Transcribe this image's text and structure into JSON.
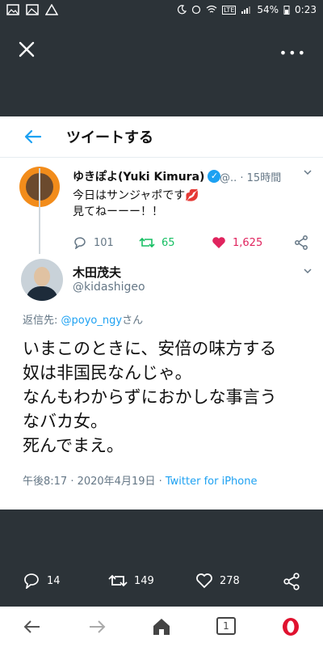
{
  "status_bar": {
    "battery": "54%",
    "time": "0:23"
  },
  "header": {
    "title": "ツイートする"
  },
  "tweet1": {
    "name": "ゆきぽよ(Yuki Kimura)",
    "meta": "@.. · 15時間",
    "text": "今日はサンジャポです💋\n見てねーーー！！",
    "replies": "101",
    "retweets": "65",
    "likes": "1,625"
  },
  "tweet2": {
    "name": "木田茂夫",
    "handle": "@kidashigeo",
    "reply_prefix": "返信先: ",
    "reply_to": "@poyo_ngy",
    "reply_suffix": "さん",
    "text": "いまこのときに、安倍の味方する\n奴は非国民なんじゃ。\nなんもわからずにおかしな事言う\nなバカ女。\n死んでまえ。",
    "timestamp": "午後8:17 · 2020年4月19日 · ",
    "source": "Twitter for iPhone"
  },
  "bottom_actions": {
    "replies": "14",
    "retweets": "149",
    "likes": "278"
  },
  "nav": {
    "tabs_count": "1"
  },
  "colors": {
    "dark_bg": "#2c3338",
    "accent": "#1da1f2",
    "retweet": "#17bf63",
    "like": "#e0245e"
  }
}
